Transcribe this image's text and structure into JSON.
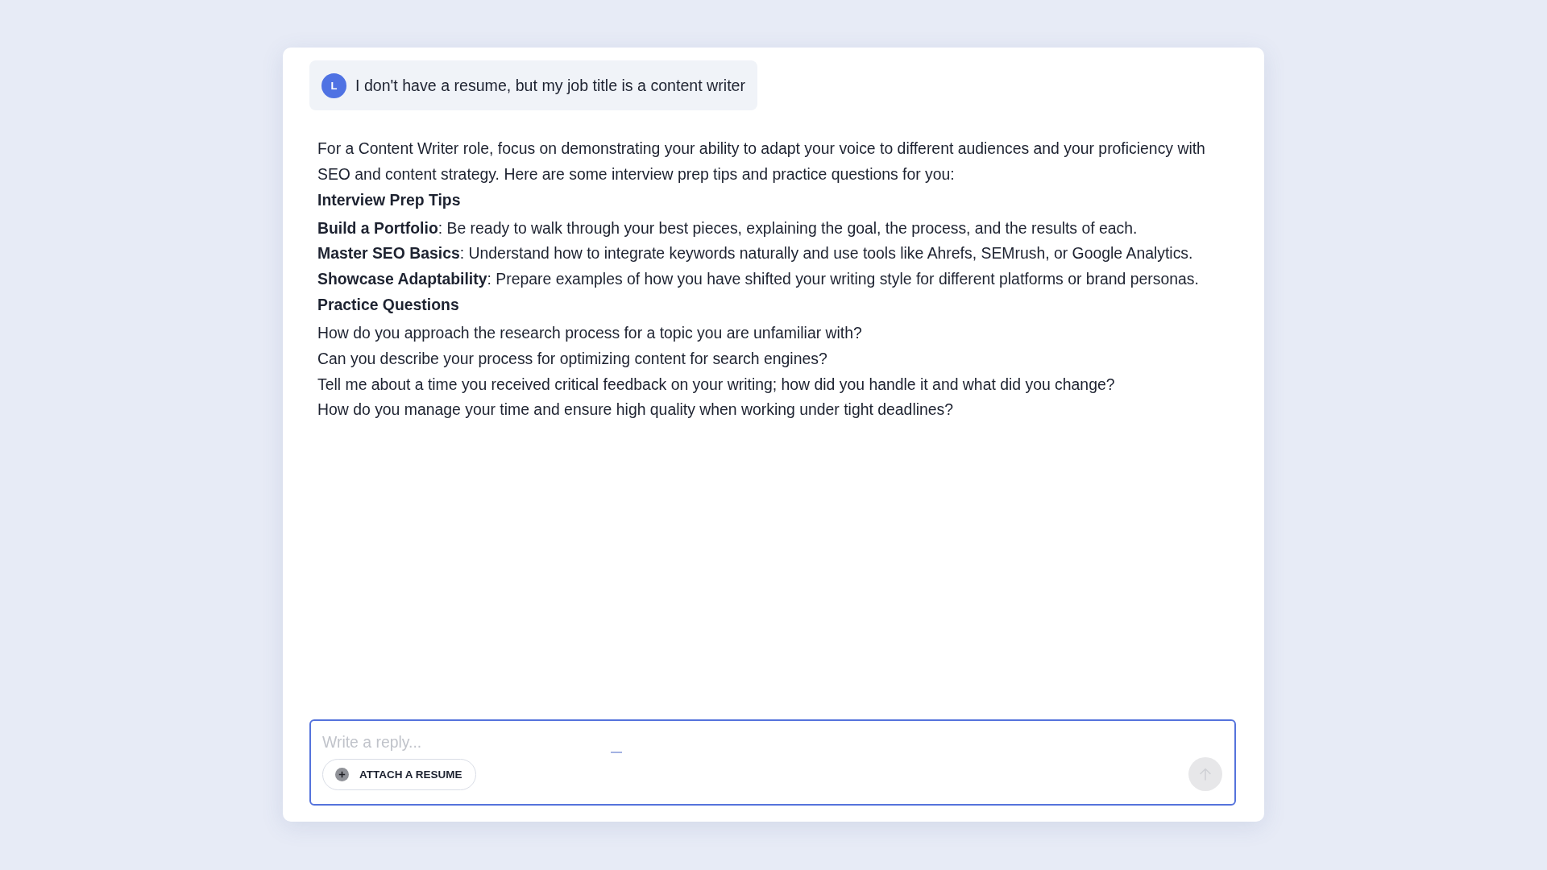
{
  "user_message": {
    "avatar_letter": "L",
    "text": "I don't have a resume, but my job title is a content writer"
  },
  "response": {
    "intro": "For a Content Writer role, focus on demonstrating your ability to adapt your voice to different audiences and your proficiency with SEO and content strategy. Here are some interview prep tips and practice questions for you:",
    "sections": [
      {
        "heading": "Interview Prep Tips",
        "items": [
          "**Build a Portfolio**: Be ready to walk through your best pieces, explaining the goal, the process, and the results of each.",
          "**Master SEO Basics**: Understand how to integrate keywords naturally and use tools like Ahrefs, SEMrush, or Google Analytics.",
          "**Showcase Adaptability**: Prepare examples of how you have shifted your writing style for different platforms or brand personas."
        ]
      },
      {
        "heading": "Practice Questions",
        "items": [
          "How do you approach the research process for a topic you are unfamiliar with?",
          "Can you describe your process for optimizing content for search engines?",
          "Tell me about a time you received critical feedback on your writing; how did you handle it and what did you change?",
          "How do you manage your time and ensure high quality when working under tight deadlines?"
        ]
      }
    ]
  },
  "composer": {
    "placeholder": "Write a reply...",
    "attach_button": "ATTACH A RESUME",
    "send_button": {
      "disabled": true
    }
  }
}
